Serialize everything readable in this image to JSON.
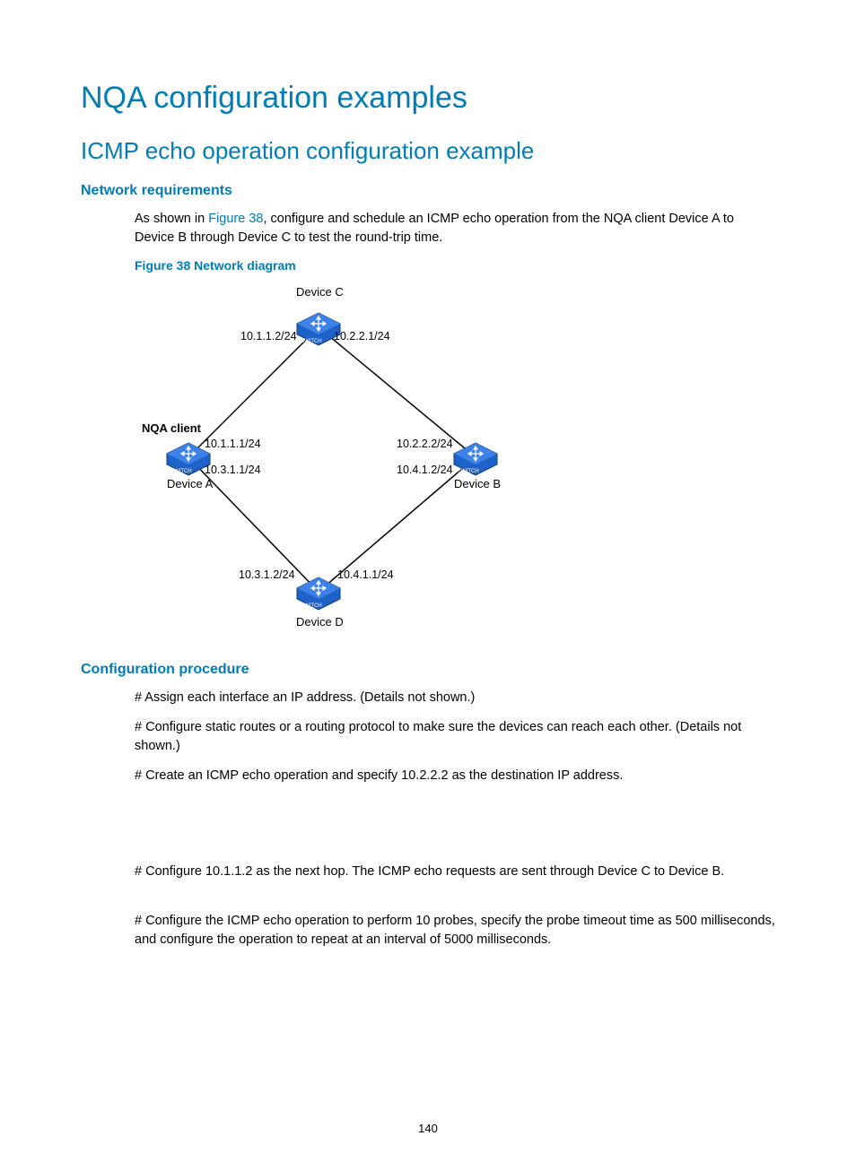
{
  "headings": {
    "h1": "NQA configuration examples",
    "h2": "ICMP echo operation configuration example",
    "h3_req": "Network requirements",
    "fig": "Figure 38 Network diagram",
    "h3_proc": "Configuration procedure"
  },
  "intro": {
    "pre": "As shown in ",
    "link": "Figure 38",
    "post": ", configure and schedule an ICMP echo operation from the NQA client Device A to Device B through Device C to test the round-trip time."
  },
  "diagram": {
    "nqa_client": "NQA client",
    "device_a": "Device A",
    "device_b": "Device B",
    "device_c": "Device C",
    "device_d": "Device D",
    "ip_ac": "10.1.1.2/24",
    "ip_cb": "10.2.2.1/24",
    "ip_a_top": "10.1.1.1/24",
    "ip_a_bot": "10.3.1.1/24",
    "ip_b_top": "10.2.2.2/24",
    "ip_b_bot": "10.4.1.2/24",
    "ip_ad": "10.3.1.2/24",
    "ip_db": "10.4.1.1/24"
  },
  "proc": {
    "p1": "# Assign each interface an IP address. (Details not shown.)",
    "p2": "# Configure static routes or a routing protocol to make sure the devices can reach each other. (Details not shown.)",
    "p3": "# Create an ICMP echo operation and specify 10.2.2.2 as the destination IP address.",
    "p4": "# Configure 10.1.1.2 as the next hop. The ICMP echo requests are sent through Device C to Device B.",
    "p5": "# Configure the ICMP echo operation to perform 10 probes, specify the probe timeout time as 500 milliseconds, and configure the operation to repeat at an interval of 5000 milliseconds."
  },
  "page_number": "140"
}
